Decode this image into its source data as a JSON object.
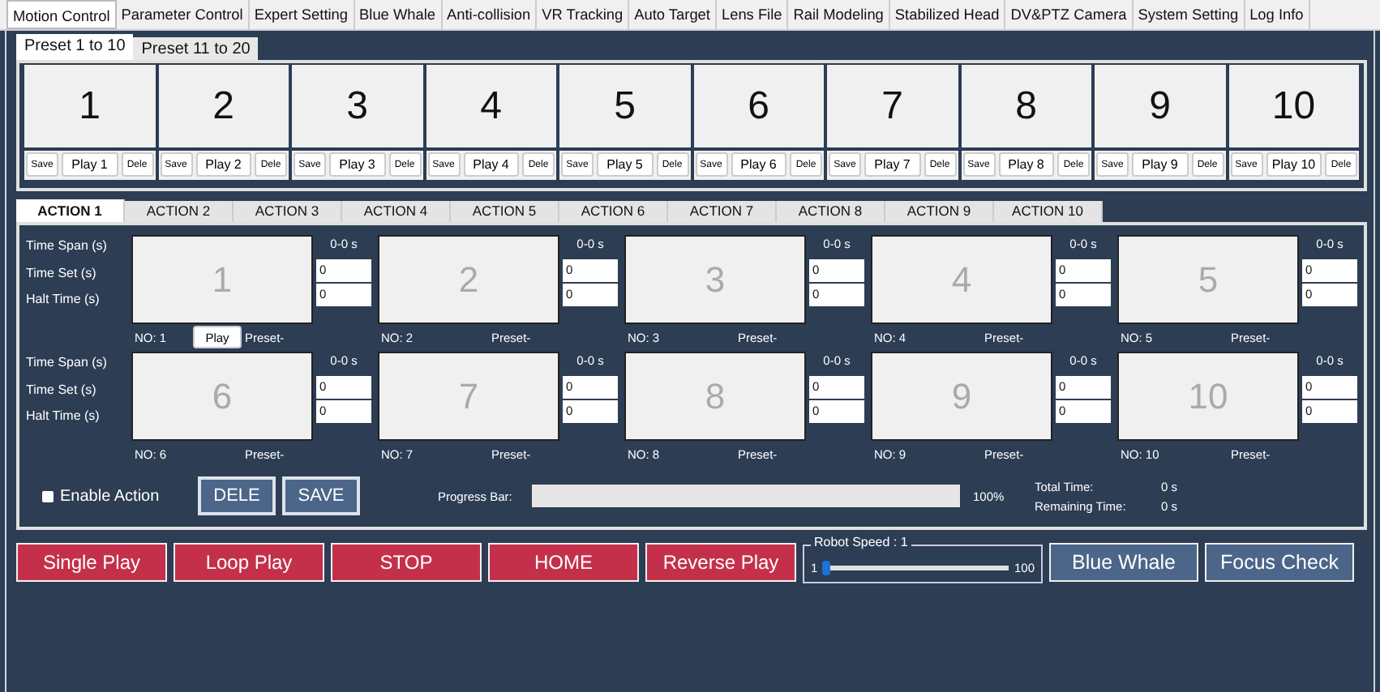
{
  "main_tabs": [
    {
      "label": "Motion Control",
      "selected": true
    },
    {
      "label": "Parameter Control",
      "selected": false
    },
    {
      "label": "Expert Setting",
      "selected": false
    },
    {
      "label": "Blue Whale",
      "selected": false
    },
    {
      "label": "Anti-collision",
      "selected": false
    },
    {
      "label": "VR Tracking",
      "selected": false
    },
    {
      "label": "Auto Target",
      "selected": false
    },
    {
      "label": "Lens File",
      "selected": false
    },
    {
      "label": "Rail Modeling",
      "selected": false
    },
    {
      "label": "Stabilized Head",
      "selected": false
    },
    {
      "label": "DV&PTZ Camera",
      "selected": false
    },
    {
      "label": "System Setting",
      "selected": false
    },
    {
      "label": "Log Info",
      "selected": false
    }
  ],
  "preset_tabs": [
    {
      "label": "Preset 1 to 10",
      "selected": true
    },
    {
      "label": "Preset 11 to 20",
      "selected": false
    }
  ],
  "presets": [
    {
      "number": "1",
      "save": "Save",
      "play": "Play 1",
      "dele": "Dele"
    },
    {
      "number": "2",
      "save": "Save",
      "play": "Play 2",
      "dele": "Dele"
    },
    {
      "number": "3",
      "save": "Save",
      "play": "Play 3",
      "dele": "Dele"
    },
    {
      "number": "4",
      "save": "Save",
      "play": "Play 4",
      "dele": "Dele"
    },
    {
      "number": "5",
      "save": "Save",
      "play": "Play 5",
      "dele": "Dele"
    },
    {
      "number": "6",
      "save": "Save",
      "play": "Play 6",
      "dele": "Dele"
    },
    {
      "number": "7",
      "save": "Save",
      "play": "Play 7",
      "dele": "Dele"
    },
    {
      "number": "8",
      "save": "Save",
      "play": "Play 8",
      "dele": "Dele"
    },
    {
      "number": "9",
      "save": "Save",
      "play": "Play 9",
      "dele": "Dele"
    },
    {
      "number": "10",
      "save": "Save",
      "play": "Play 10",
      "dele": "Dele"
    }
  ],
  "action_tabs": [
    {
      "label": "ACTION 1",
      "selected": true
    },
    {
      "label": "ACTION 2",
      "selected": false
    },
    {
      "label": "ACTION 3",
      "selected": false
    },
    {
      "label": "ACTION 4",
      "selected": false
    },
    {
      "label": "ACTION 5",
      "selected": false
    },
    {
      "label": "ACTION 6",
      "selected": false
    },
    {
      "label": "ACTION 7",
      "selected": false
    },
    {
      "label": "ACTION 8",
      "selected": false
    },
    {
      "label": "ACTION 9",
      "selected": false
    },
    {
      "label": "ACTION 10",
      "selected": false
    }
  ],
  "action_rows": [
    {
      "labels": [
        "Time Span (s)",
        "Time Set (s)",
        "Halt Time (s)"
      ],
      "slots": [
        {
          "number": "1",
          "span": "0-0 s",
          "time_set": "0",
          "halt_time": "0",
          "no": "NO: 1",
          "play": "Play",
          "preset": "Preset-"
        },
        {
          "number": "2",
          "span": "0-0 s",
          "time_set": "0",
          "halt_time": "0",
          "no": "NO: 2",
          "preset": "Preset-"
        },
        {
          "number": "3",
          "span": "0-0 s",
          "time_set": "0",
          "halt_time": "0",
          "no": "NO: 3",
          "preset": "Preset-"
        },
        {
          "number": "4",
          "span": "0-0 s",
          "time_set": "0",
          "halt_time": "0",
          "no": "NO: 4",
          "preset": "Preset-"
        },
        {
          "number": "5",
          "span": "0-0 s",
          "time_set": "0",
          "halt_time": "0",
          "no": "NO: 5",
          "preset": "Preset-"
        }
      ]
    },
    {
      "labels": [
        "Time Span (s)",
        "Time Set (s)",
        "Halt Time (s)"
      ],
      "slots": [
        {
          "number": "6",
          "span": "0-0 s",
          "time_set": "0",
          "halt_time": "0",
          "no": "NO: 6",
          "preset": "Preset-"
        },
        {
          "number": "7",
          "span": "0-0 s",
          "time_set": "0",
          "halt_time": "0",
          "no": "NO: 7",
          "preset": "Preset-"
        },
        {
          "number": "8",
          "span": "0-0 s",
          "time_set": "0",
          "halt_time": "0",
          "no": "NO: 8",
          "preset": "Preset-"
        },
        {
          "number": "9",
          "span": "0-0 s",
          "time_set": "0",
          "halt_time": "0",
          "no": "NO: 9",
          "preset": "Preset-"
        },
        {
          "number": "10",
          "span": "0-0 s",
          "time_set": "0",
          "halt_time": "0",
          "no": "NO: 10",
          "preset": "Preset-"
        }
      ]
    }
  ],
  "enable_action": {
    "label": "Enable Action",
    "checked": false
  },
  "action_buttons": [
    "DELE",
    "SAVE"
  ],
  "progress": {
    "label": "Progress Bar:",
    "reading": "100%",
    "level": 0
  },
  "total_time": {
    "label": "Total Time:",
    "value": "0 s"
  },
  "remaining_time": {
    "label": "Remaining Time:",
    "value": "0 s"
  },
  "play_buttons": [
    "Single Play",
    "Loop Play",
    "STOP",
    "HOME",
    "Reverse Play"
  ],
  "robot_speed": {
    "label": "Robot Speed : 1",
    "min": "1",
    "max": "100",
    "level": 0
  },
  "side_buttons": [
    "Blue Whale",
    "Focus Check"
  ]
}
